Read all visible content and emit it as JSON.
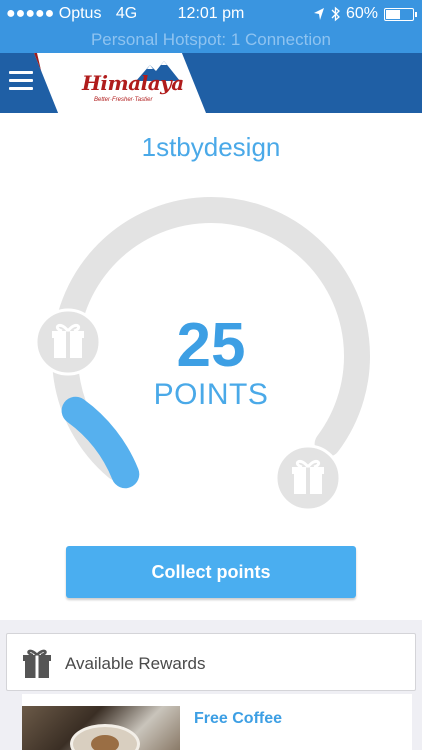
{
  "status_bar": {
    "carrier": "●●●●● Optus",
    "network": "4G",
    "time": "12:01 pm",
    "battery": "60%",
    "battery_level": 0.6
  },
  "hotspot": {
    "text": "Personal Hotspot: 1 Connection"
  },
  "nav": {
    "brand_name": "Himalaya",
    "brand_tagline": "Better·Fresher·Tastier"
  },
  "page": {
    "title": "1stbydesign"
  },
  "points": {
    "value": "25",
    "label": "POINTS",
    "progress_fraction": 0.12
  },
  "actions": {
    "collect_label": "Collect points"
  },
  "rewards": {
    "header_label": "Available Rewards",
    "items": [
      {
        "title": "Free Coffee"
      }
    ]
  },
  "colors": {
    "accent": "#3d9fe4",
    "status_bar": "#3a95e0",
    "nav_bar": "#1f5fa5",
    "ring_track": "#e3e3e3",
    "ring_progress": "#56b0ee"
  },
  "icons": {
    "menu": "hamburger-icon",
    "reward_start": "gift-icon",
    "reward_end": "gift-icon",
    "rewards_header": "gift-icon"
  }
}
